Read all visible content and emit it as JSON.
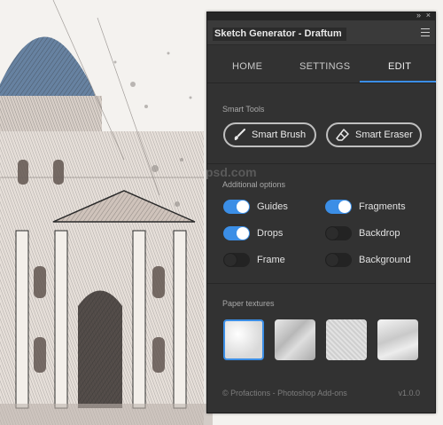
{
  "panel": {
    "title": "Sketch Generator - Draftum",
    "window_controls": {
      "collapse": "»",
      "close": "×"
    },
    "menu_icon": "hamburger-menu-icon"
  },
  "tabs": [
    {
      "label": "HOME",
      "active": false
    },
    {
      "label": "SETTINGS",
      "active": false
    },
    {
      "label": "EDIT",
      "active": true
    }
  ],
  "accent": "#3b8ee6",
  "smart_tools": {
    "title": "Smart Tools",
    "buttons": [
      {
        "label": "Smart Brush",
        "icon": "brush-icon"
      },
      {
        "label": "Smart Eraser",
        "icon": "eraser-icon"
      }
    ]
  },
  "additional": {
    "title": "Additional options",
    "options": [
      {
        "label": "Guides",
        "on": true
      },
      {
        "label": "Fragments",
        "on": true
      },
      {
        "label": "Drops",
        "on": true
      },
      {
        "label": "Backdrop",
        "on": false
      },
      {
        "label": "Frame",
        "on": false
      },
      {
        "label": "Background",
        "on": false
      }
    ]
  },
  "textures": {
    "title": "Paper textures",
    "selected_index": 0,
    "count": 4
  },
  "footer": {
    "credit": "© Profactions - Photoshop Add-ons",
    "version": "v1.0.0"
  },
  "watermark": "psd.com"
}
